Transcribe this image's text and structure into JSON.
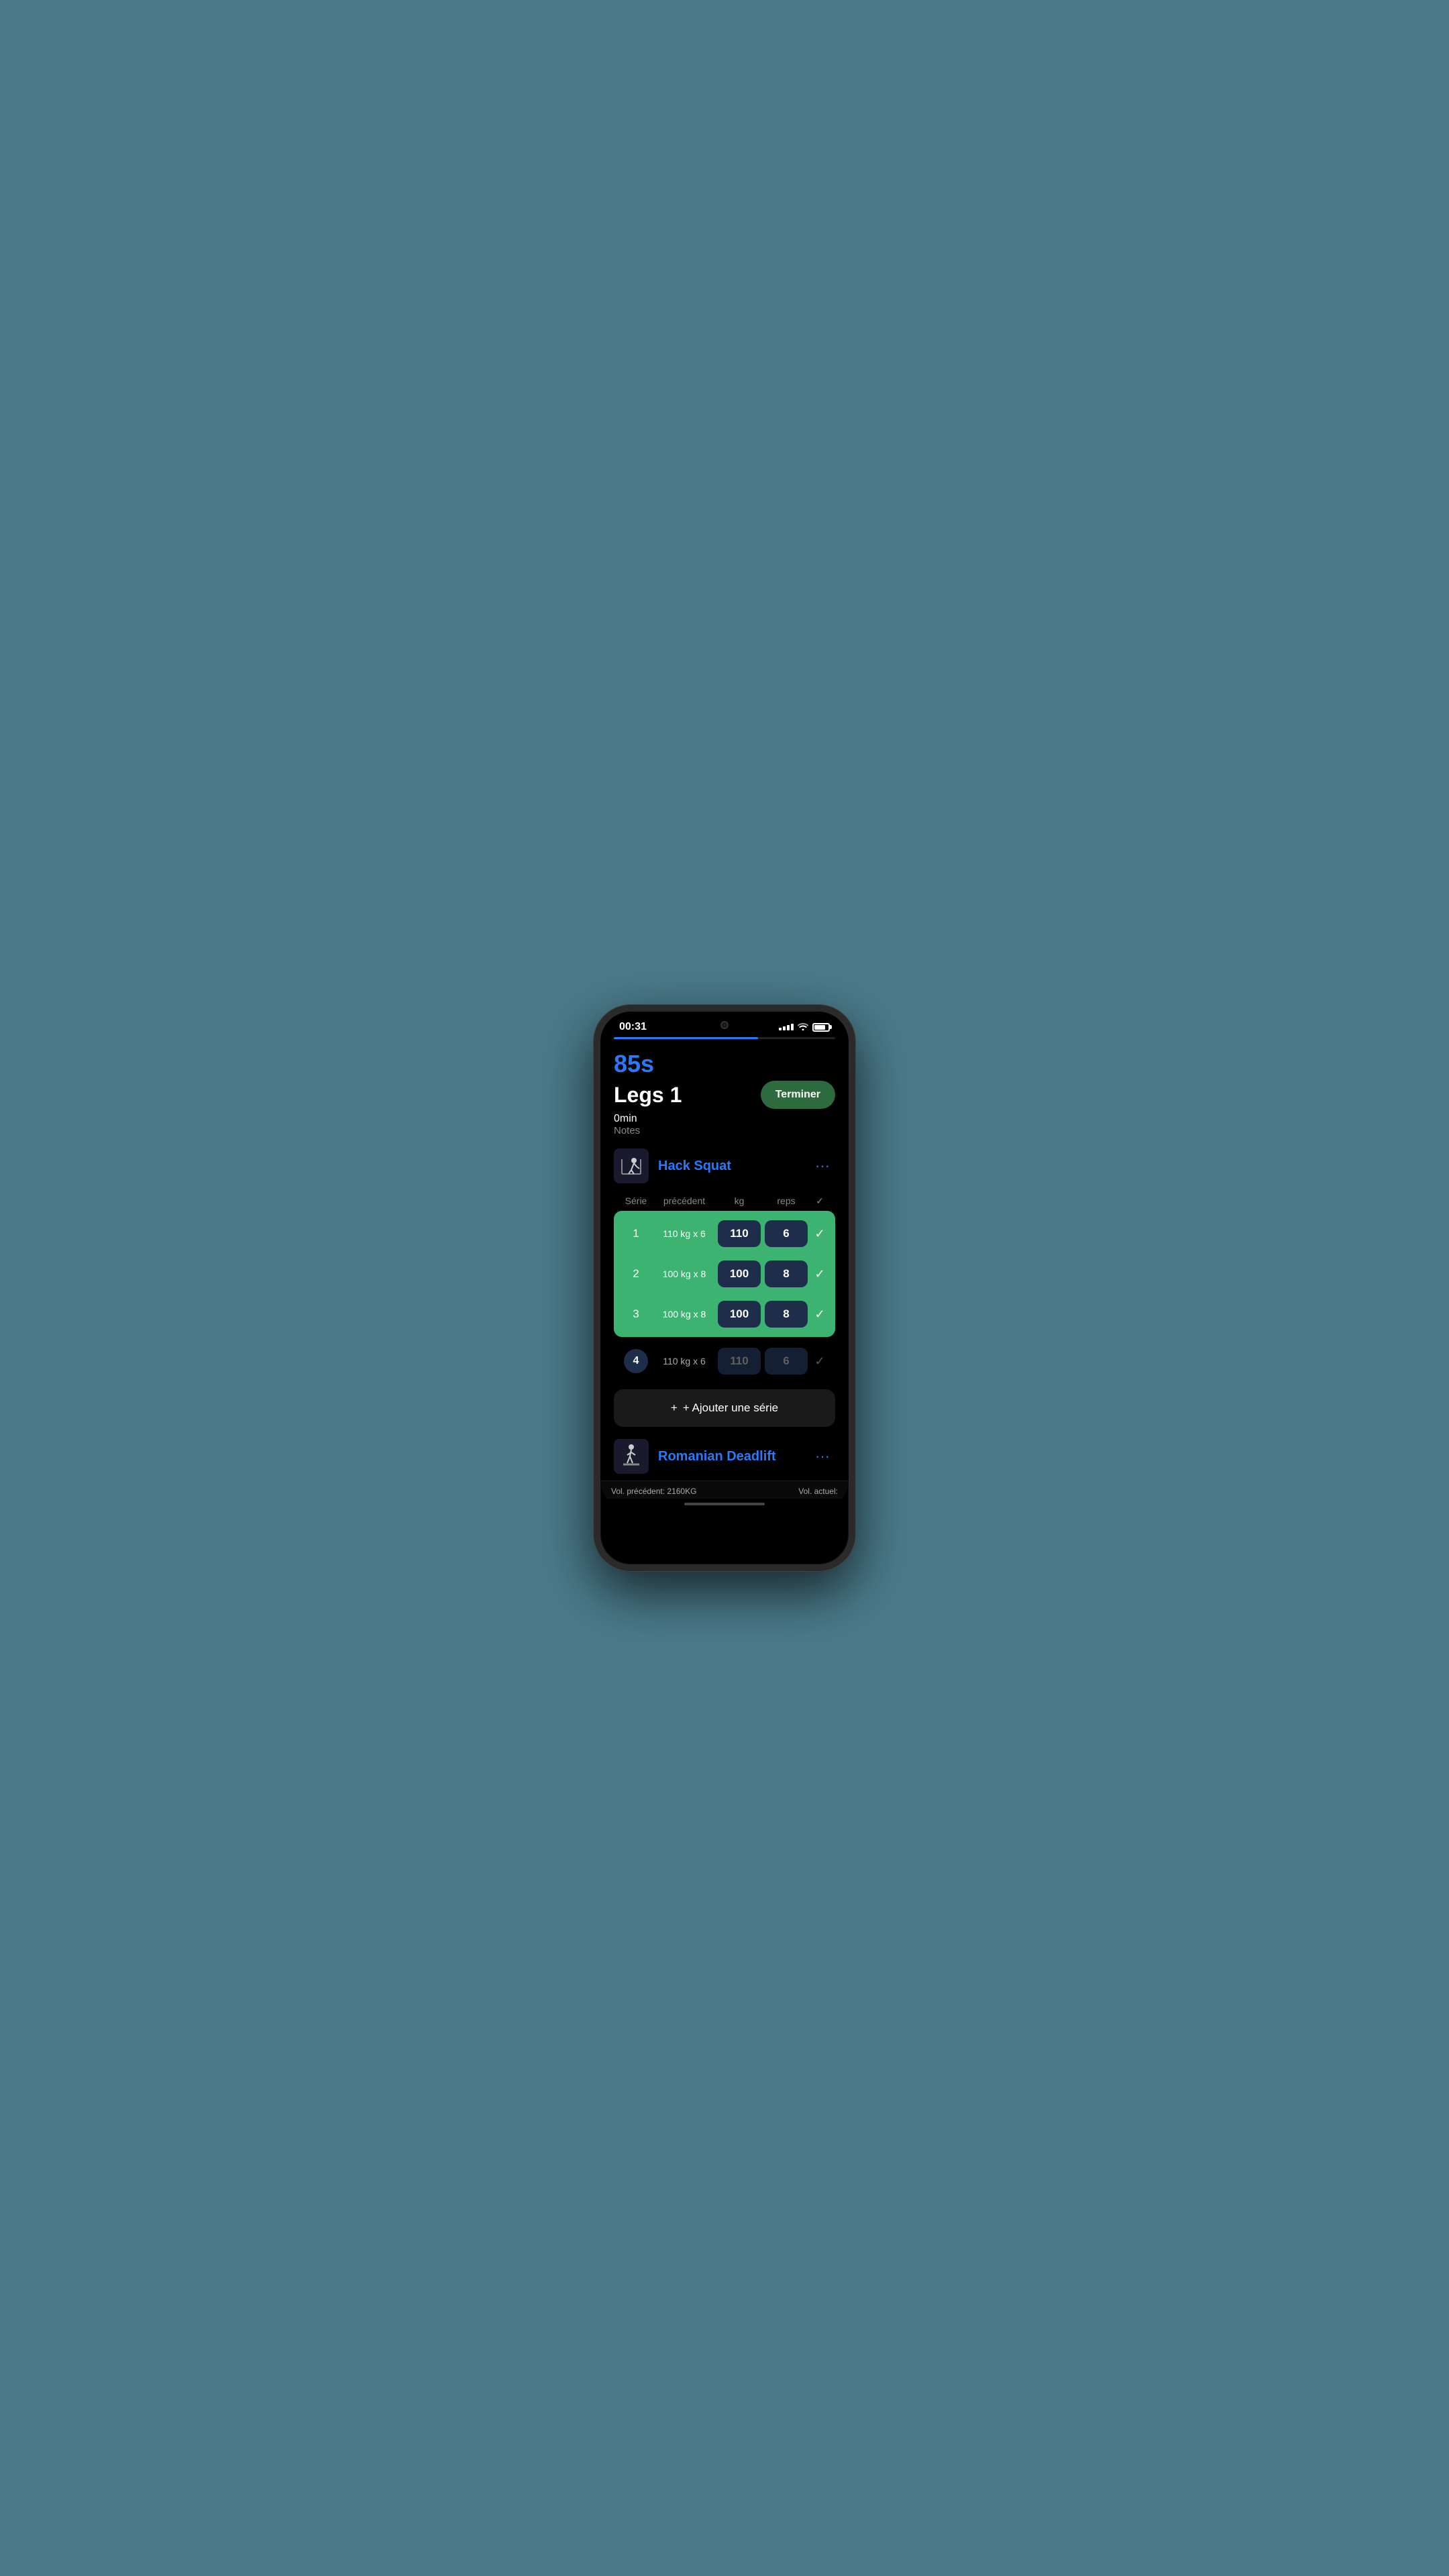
{
  "statusBar": {
    "time": "00:31",
    "batteryLevel": 80
  },
  "progressBar": {
    "fillPercent": 65
  },
  "workout": {
    "timer": "85s",
    "title": "Legs 1",
    "duration": "0min",
    "notes": "Notes",
    "terminateLabel": "Terminer"
  },
  "exercises": [
    {
      "id": "hack-squat",
      "name": "Hack Squat",
      "tableHeaders": {
        "serie": "Série",
        "precedent": "précédent",
        "kg": "kg",
        "reps": "reps"
      },
      "completedSets": [
        {
          "number": "1",
          "previous": "110 kg x 6",
          "kg": "110",
          "reps": "6"
        },
        {
          "number": "2",
          "previous": "100 kg x 8",
          "kg": "100",
          "reps": "8"
        },
        {
          "number": "3",
          "previous": "100 kg x 8",
          "kg": "100",
          "reps": "8"
        }
      ],
      "pendingSets": [
        {
          "number": "4",
          "previous": "110 kg x 6",
          "kg": "110",
          "reps": "6"
        }
      ],
      "addSeriesLabel": "+ Ajouter une série"
    },
    {
      "id": "romanian-deadlift",
      "name": "Romanian Deadlift"
    }
  ],
  "bottomBar": {
    "volPrecedentLabel": "Vol. précédent:",
    "volPrecedentValue": "2160KG",
    "volActuelLabel": "Vol. actuel:"
  },
  "icons": {
    "moreOptions": "···",
    "checkmark": "✓",
    "plus": "+"
  }
}
